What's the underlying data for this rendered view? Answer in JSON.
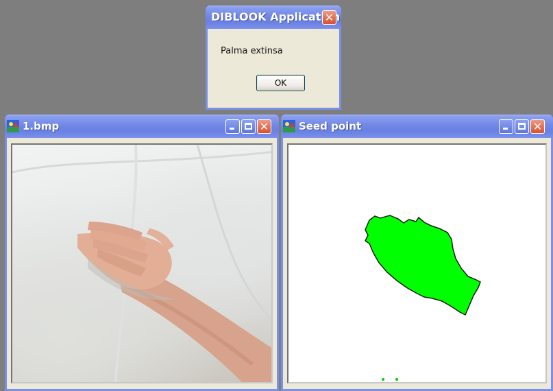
{
  "dialog": {
    "title": "DIBLOOK Application",
    "message": "Palma extinsa",
    "ok_label": "OK"
  },
  "windows": [
    {
      "title": "1.bmp"
    },
    {
      "title": "Seed point"
    }
  ],
  "colors": {
    "titlebar": "#7288e6",
    "window_border": "#7a8fe8",
    "close_button": "#d8502e",
    "segment_fill": "#00ff00",
    "desktop": "#7e7e7e"
  },
  "icons": {
    "window_icon": "diblook-app-icon",
    "minimize": "minimize-icon",
    "maximize": "maximize-icon",
    "close": "close-icon"
  }
}
